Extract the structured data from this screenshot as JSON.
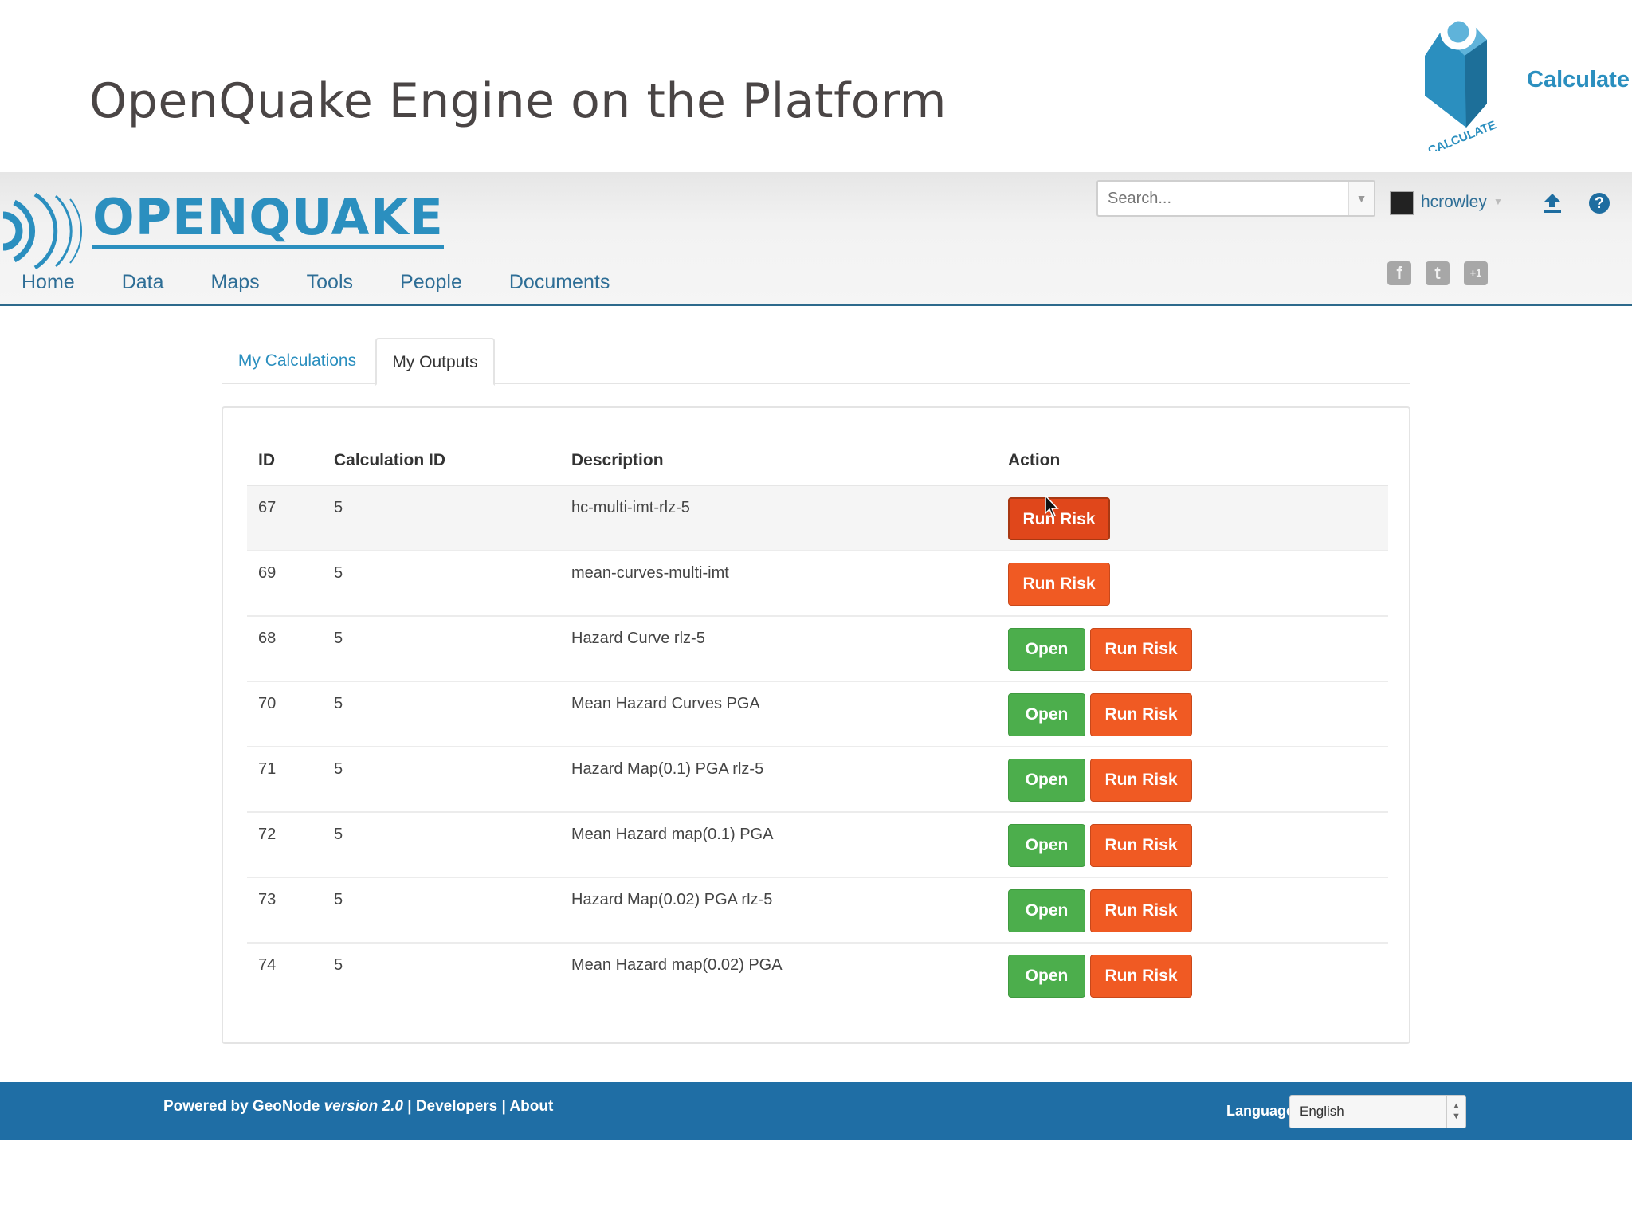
{
  "slide": {
    "title": "OpenQuake Engine on the Platform",
    "brand_label": "Calculate",
    "brand_logo_text": "CALCULATE",
    "brand_color": "#2b8fbf"
  },
  "header": {
    "logo_text": "OPENQUAKE",
    "nav": [
      "Home",
      "Data",
      "Maps",
      "Tools",
      "People",
      "Documents"
    ],
    "search_placeholder": "Search...",
    "username": "hcrowley",
    "social": [
      "f",
      "t",
      "+1"
    ]
  },
  "tabs": [
    {
      "label": "My Calculations",
      "active": false
    },
    {
      "label": "My Outputs",
      "active": true
    }
  ],
  "table": {
    "headers": {
      "id": "ID",
      "calc_id": "Calculation ID",
      "description": "Description",
      "action": "Action"
    },
    "rows": [
      {
        "id": "67",
        "calc_id": "5",
        "description": "hc-multi-imt-rlz-5",
        "open": false
      },
      {
        "id": "69",
        "calc_id": "5",
        "description": "mean-curves-multi-imt",
        "open": false
      },
      {
        "id": "68",
        "calc_id": "5",
        "description": "Hazard Curve rlz-5",
        "open": true
      },
      {
        "id": "70",
        "calc_id": "5",
        "description": "Mean Hazard Curves PGA",
        "open": true
      },
      {
        "id": "71",
        "calc_id": "5",
        "description": "Hazard Map(0.1) PGA rlz-5",
        "open": true
      },
      {
        "id": "72",
        "calc_id": "5",
        "description": "Mean Hazard map(0.1) PGA",
        "open": true
      },
      {
        "id": "73",
        "calc_id": "5",
        "description": "Hazard Map(0.02) PGA rlz-5",
        "open": true
      },
      {
        "id": "74",
        "calc_id": "5",
        "description": "Mean Hazard map(0.02) PGA",
        "open": true
      }
    ],
    "open_label": "Open",
    "run_risk_label": "Run Risk"
  },
  "footer": {
    "powered_prefix": "Powered by GeoNode",
    "version": "version 2.0",
    "links": "| Developers | About",
    "language_label": "Language",
    "language_value": "English"
  },
  "colors": {
    "accent": "#2b8fbf",
    "open_button": "#4cae4c",
    "run_risk_button": "#f05a23",
    "footer": "#1f6ea5"
  }
}
